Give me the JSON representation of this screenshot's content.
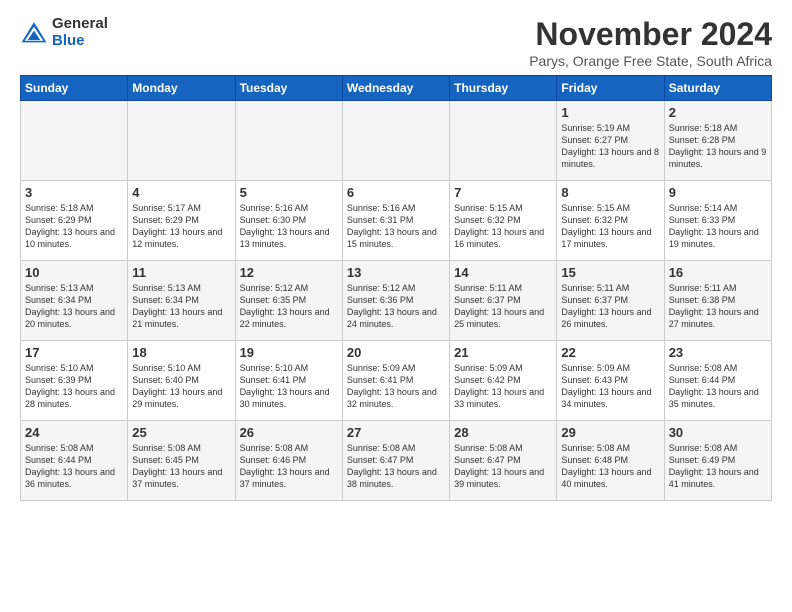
{
  "logo": {
    "general": "General",
    "blue": "Blue"
  },
  "title": "November 2024",
  "subtitle": "Parys, Orange Free State, South Africa",
  "days_of_week": [
    "Sunday",
    "Monday",
    "Tuesday",
    "Wednesday",
    "Thursday",
    "Friday",
    "Saturday"
  ],
  "weeks": [
    [
      {
        "day": "",
        "info": ""
      },
      {
        "day": "",
        "info": ""
      },
      {
        "day": "",
        "info": ""
      },
      {
        "day": "",
        "info": ""
      },
      {
        "day": "",
        "info": ""
      },
      {
        "day": "1",
        "info": "Sunrise: 5:19 AM\nSunset: 6:27 PM\nDaylight: 13 hours and 8 minutes."
      },
      {
        "day": "2",
        "info": "Sunrise: 5:18 AM\nSunset: 6:28 PM\nDaylight: 13 hours and 9 minutes."
      }
    ],
    [
      {
        "day": "3",
        "info": "Sunrise: 5:18 AM\nSunset: 6:29 PM\nDaylight: 13 hours and 10 minutes."
      },
      {
        "day": "4",
        "info": "Sunrise: 5:17 AM\nSunset: 6:29 PM\nDaylight: 13 hours and 12 minutes."
      },
      {
        "day": "5",
        "info": "Sunrise: 5:16 AM\nSunset: 6:30 PM\nDaylight: 13 hours and 13 minutes."
      },
      {
        "day": "6",
        "info": "Sunrise: 5:16 AM\nSunset: 6:31 PM\nDaylight: 13 hours and 15 minutes."
      },
      {
        "day": "7",
        "info": "Sunrise: 5:15 AM\nSunset: 6:32 PM\nDaylight: 13 hours and 16 minutes."
      },
      {
        "day": "8",
        "info": "Sunrise: 5:15 AM\nSunset: 6:32 PM\nDaylight: 13 hours and 17 minutes."
      },
      {
        "day": "9",
        "info": "Sunrise: 5:14 AM\nSunset: 6:33 PM\nDaylight: 13 hours and 19 minutes."
      }
    ],
    [
      {
        "day": "10",
        "info": "Sunrise: 5:13 AM\nSunset: 6:34 PM\nDaylight: 13 hours and 20 minutes."
      },
      {
        "day": "11",
        "info": "Sunrise: 5:13 AM\nSunset: 6:34 PM\nDaylight: 13 hours and 21 minutes."
      },
      {
        "day": "12",
        "info": "Sunrise: 5:12 AM\nSunset: 6:35 PM\nDaylight: 13 hours and 22 minutes."
      },
      {
        "day": "13",
        "info": "Sunrise: 5:12 AM\nSunset: 6:36 PM\nDaylight: 13 hours and 24 minutes."
      },
      {
        "day": "14",
        "info": "Sunrise: 5:11 AM\nSunset: 6:37 PM\nDaylight: 13 hours and 25 minutes."
      },
      {
        "day": "15",
        "info": "Sunrise: 5:11 AM\nSunset: 6:37 PM\nDaylight: 13 hours and 26 minutes."
      },
      {
        "day": "16",
        "info": "Sunrise: 5:11 AM\nSunset: 6:38 PM\nDaylight: 13 hours and 27 minutes."
      }
    ],
    [
      {
        "day": "17",
        "info": "Sunrise: 5:10 AM\nSunset: 6:39 PM\nDaylight: 13 hours and 28 minutes."
      },
      {
        "day": "18",
        "info": "Sunrise: 5:10 AM\nSunset: 6:40 PM\nDaylight: 13 hours and 29 minutes."
      },
      {
        "day": "19",
        "info": "Sunrise: 5:10 AM\nSunset: 6:41 PM\nDaylight: 13 hours and 30 minutes."
      },
      {
        "day": "20",
        "info": "Sunrise: 5:09 AM\nSunset: 6:41 PM\nDaylight: 13 hours and 32 minutes."
      },
      {
        "day": "21",
        "info": "Sunrise: 5:09 AM\nSunset: 6:42 PM\nDaylight: 13 hours and 33 minutes."
      },
      {
        "day": "22",
        "info": "Sunrise: 5:09 AM\nSunset: 6:43 PM\nDaylight: 13 hours and 34 minutes."
      },
      {
        "day": "23",
        "info": "Sunrise: 5:08 AM\nSunset: 6:44 PM\nDaylight: 13 hours and 35 minutes."
      }
    ],
    [
      {
        "day": "24",
        "info": "Sunrise: 5:08 AM\nSunset: 6:44 PM\nDaylight: 13 hours and 36 minutes."
      },
      {
        "day": "25",
        "info": "Sunrise: 5:08 AM\nSunset: 6:45 PM\nDaylight: 13 hours and 37 minutes."
      },
      {
        "day": "26",
        "info": "Sunrise: 5:08 AM\nSunset: 6:46 PM\nDaylight: 13 hours and 37 minutes."
      },
      {
        "day": "27",
        "info": "Sunrise: 5:08 AM\nSunset: 6:47 PM\nDaylight: 13 hours and 38 minutes."
      },
      {
        "day": "28",
        "info": "Sunrise: 5:08 AM\nSunset: 6:47 PM\nDaylight: 13 hours and 39 minutes."
      },
      {
        "day": "29",
        "info": "Sunrise: 5:08 AM\nSunset: 6:48 PM\nDaylight: 13 hours and 40 minutes."
      },
      {
        "day": "30",
        "info": "Sunrise: 5:08 AM\nSunset: 6:49 PM\nDaylight: 13 hours and 41 minutes."
      }
    ]
  ]
}
